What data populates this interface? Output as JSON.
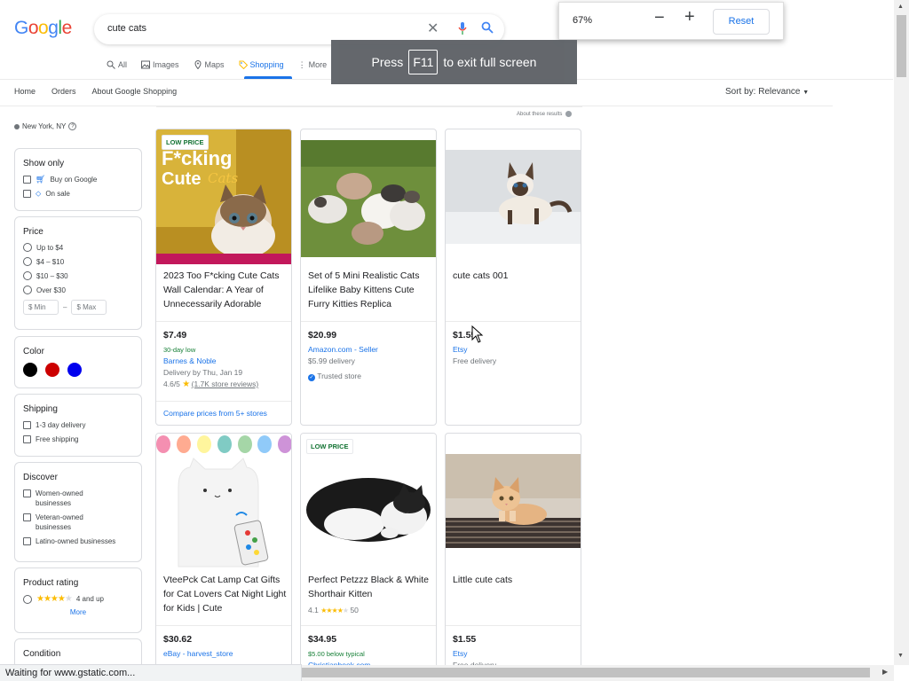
{
  "logo": "Google",
  "search": {
    "query": "cute cats"
  },
  "tabs": [
    {
      "label": "All",
      "icon": "search-icon"
    },
    {
      "label": "Images",
      "icon": "image-icon"
    },
    {
      "label": "Maps",
      "icon": "map-pin-icon"
    },
    {
      "label": "Shopping",
      "icon": "tag-icon",
      "active": true
    },
    {
      "label": "More",
      "icon": "more-vert-icon"
    }
  ],
  "subnav": [
    "Home",
    "Orders",
    "About Google Shopping"
  ],
  "sort_by": "Sort by: Relevance",
  "zoom": {
    "level": "67%",
    "reset_label": "Reset"
  },
  "fullscreen_toast": {
    "before": "Press",
    "key": "F11",
    "after": "to exit full screen"
  },
  "location": "New York, NY",
  "about_results": "About these results",
  "filters": {
    "show_only": {
      "title": "Show only",
      "options": [
        "Buy on Google",
        "On sale"
      ]
    },
    "price": {
      "title": "Price",
      "options": [
        "Up to $4",
        "$4 – $10",
        "$10 – $30",
        "Over $30"
      ],
      "min_placeholder": "$ Min",
      "max_placeholder": "$ Max",
      "dash": "–"
    },
    "color": {
      "title": "Color",
      "swatches": [
        "#000000",
        "#cc0000",
        "#0000ee"
      ]
    },
    "shipping": {
      "title": "Shipping",
      "options": [
        "1-3 day delivery",
        "Free shipping"
      ]
    },
    "discover": {
      "title": "Discover",
      "options": [
        "Women-owned businesses",
        "Veteran-owned businesses",
        "Latino-owned businesses"
      ]
    },
    "product_rating": {
      "title": "Product rating",
      "option": "4 and up",
      "more": "More"
    },
    "condition": {
      "title": "Condition"
    }
  },
  "products": [
    {
      "badge": "LOW PRICE",
      "title": "2023 Too F*cking Cute Cats Wall Calendar: A Year of Unnecessarily Adorable",
      "price": "$7.49",
      "price_note": "30-day low",
      "store": "Barnes & Noble",
      "delivery": "Delivery by Thu, Jan 19",
      "rating": "4.6/5",
      "reviews": "(1.7K store reviews)",
      "compare": "Compare prices from 5+ stores"
    },
    {
      "title": "Set of 5 Mini Realistic Cats Lifelike Baby Kittens Cute Furry Kitties Replica",
      "price": "$20.99",
      "store": "Amazon.com - Seller",
      "delivery": "$5.99 delivery",
      "trusted": "Trusted store"
    },
    {
      "title": "cute cats 001",
      "price": "$1.55",
      "store": "Etsy",
      "delivery": "Free delivery"
    },
    {
      "title": "VteePck Cat Lamp Cat Gifts for Cat Lovers Cat Night Light for Kids | Cute",
      "price": "$30.62",
      "store": "eBay - harvest_store"
    },
    {
      "badge": "LOW PRICE",
      "title": "Perfect Petzzz Black & White Shorthair Kitten",
      "rating": "4.1",
      "rating_count": "50",
      "price": "$34.95",
      "price_note": "$5.00 below typical",
      "store": "Christianbook.com"
    },
    {
      "title": "Little cute cats",
      "price": "$1.55",
      "store": "Etsy",
      "delivery": "Free delivery"
    }
  ],
  "status_bar": "Waiting for www.gstatic.com..."
}
